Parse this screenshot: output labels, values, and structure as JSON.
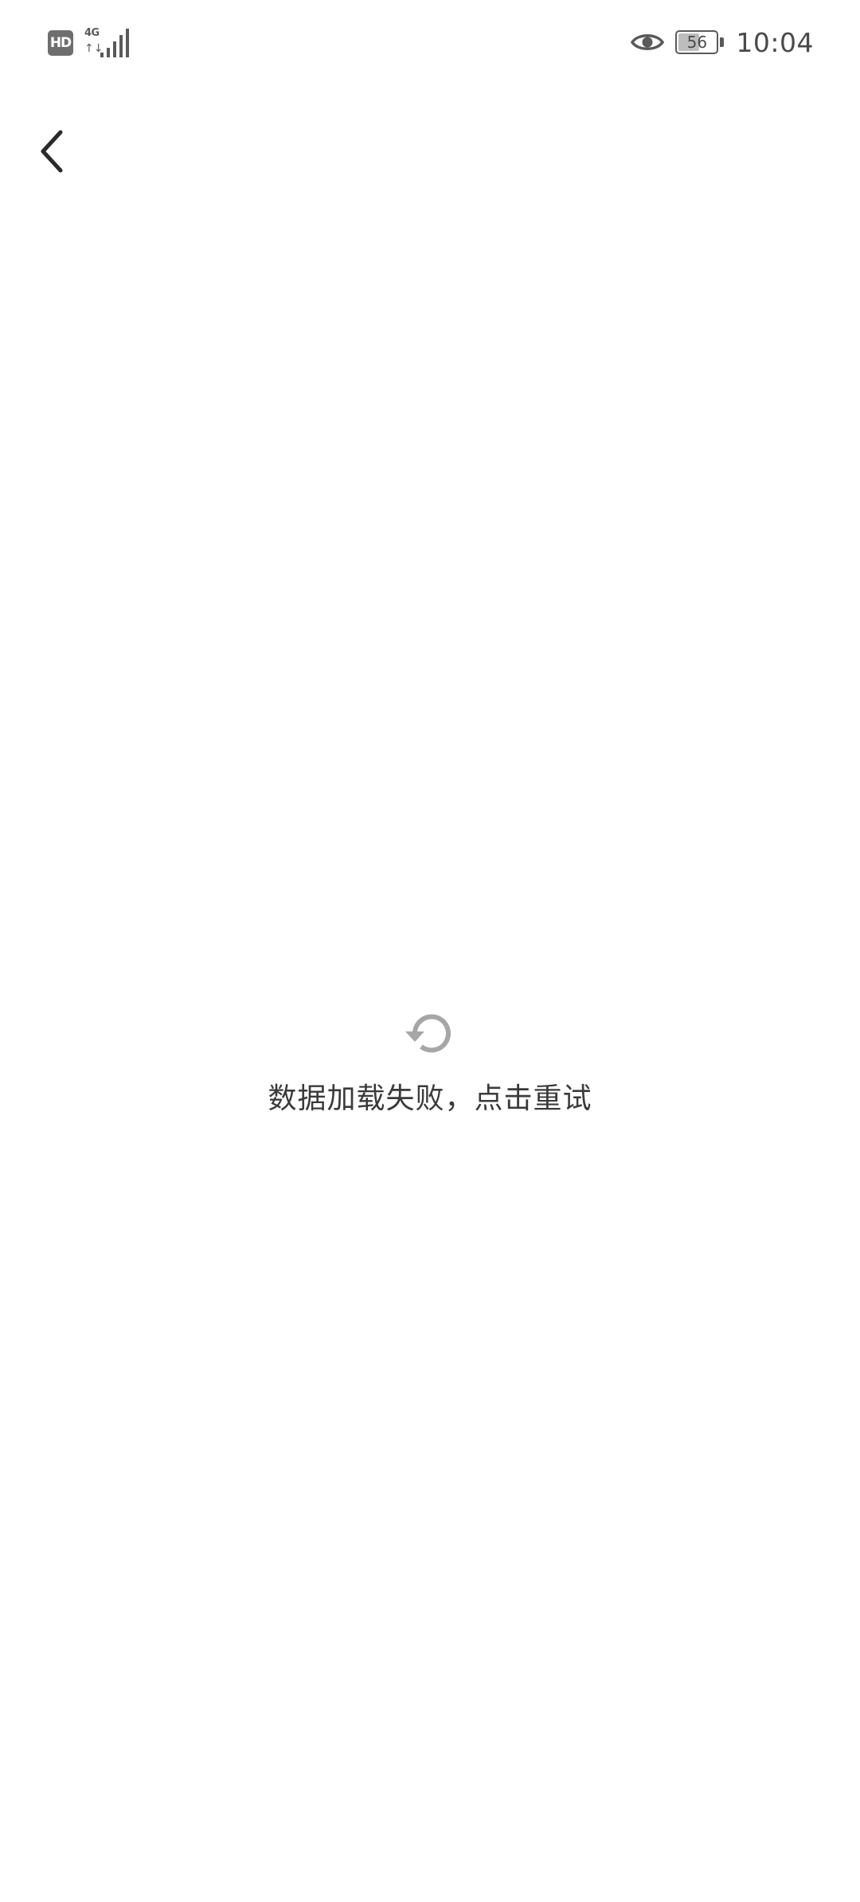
{
  "status_bar": {
    "hd_badge": "HD",
    "network_type": "4G",
    "network_arrows": "↑↓",
    "battery_level": "56",
    "battery_fraction": 0.56,
    "time": "10:04",
    "icons": [
      "hd-icon",
      "signal-icon",
      "eye-icon",
      "battery-icon"
    ]
  },
  "nav": {
    "back_icon": "chevron-left-icon"
  },
  "error": {
    "icon": "refresh-icon",
    "message": "数据加载失败，点击重试",
    "icon_color": "#a6a6a6"
  }
}
